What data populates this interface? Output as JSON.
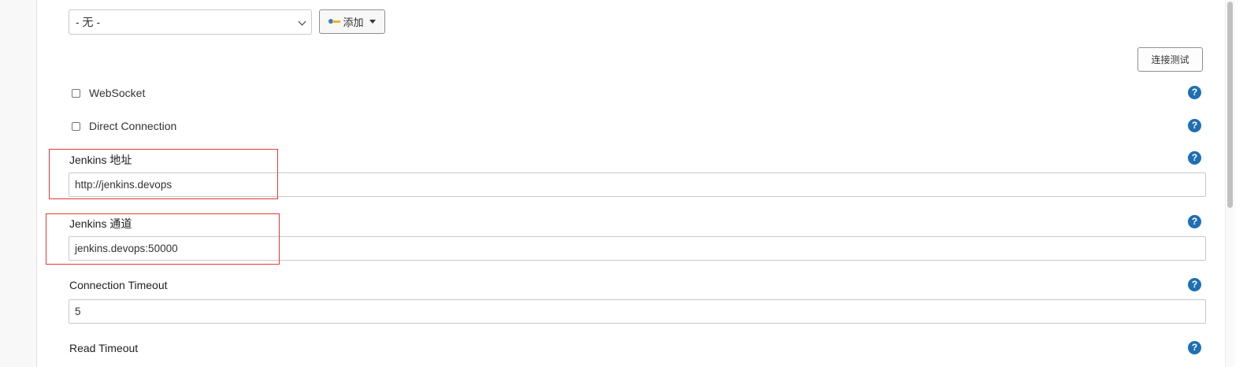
{
  "credentials": {
    "selected": "- 无 -",
    "add_button_label": "添加"
  },
  "test_connection_label": "连接测试",
  "options": {
    "websocket_label": "WebSocket",
    "direct_connection_label": "Direct Connection"
  },
  "fields": {
    "jenkins_url": {
      "label": "Jenkins 地址",
      "value": "http://jenkins.devops"
    },
    "jenkins_tunnel": {
      "label": "Jenkins 通道",
      "value": "jenkins.devops:50000"
    },
    "connection_timeout": {
      "label": "Connection Timeout",
      "value": "5"
    },
    "read_timeout": {
      "label": "Read Timeout"
    }
  },
  "help_glyph": "?",
  "annotation_color": "#e53935",
  "accent_color": "#1f6fb2"
}
